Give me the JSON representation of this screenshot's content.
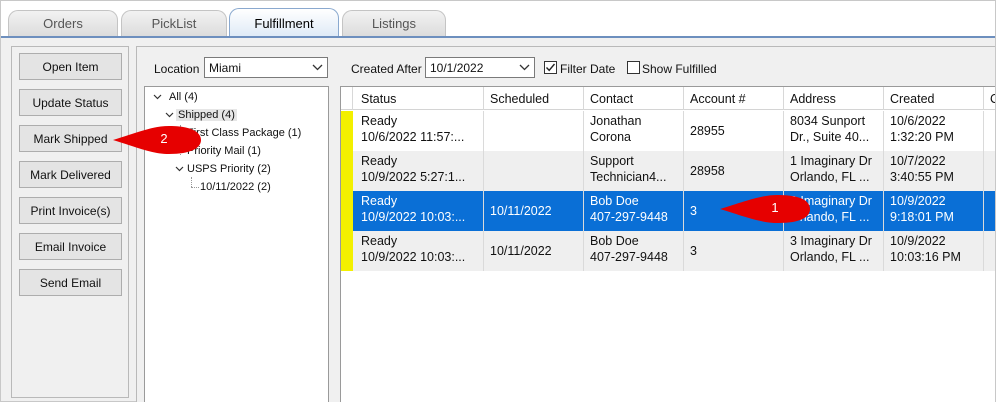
{
  "tabs": [
    {
      "label": "Orders",
      "active": false
    },
    {
      "label": "PickList",
      "active": false
    },
    {
      "label": "Fulfillment",
      "active": true
    },
    {
      "label": "Listings",
      "active": false
    }
  ],
  "sidebar_buttons": [
    {
      "label": "Open Item"
    },
    {
      "label": "Update Status"
    },
    {
      "label": "Mark Shipped"
    },
    {
      "label": "Mark Delivered"
    },
    {
      "label": "Print Invoice(s)"
    },
    {
      "label": "Email Invoice"
    },
    {
      "label": "Send Email"
    }
  ],
  "filters": {
    "location_label": "Location",
    "location_value": "Miami",
    "created_after_label": "Created After",
    "created_after_value": "10/1/2022",
    "filter_date_label": "Filter Date",
    "filter_date_checked": true,
    "show_fulfilled_label": "Show Fulfilled",
    "show_fulfilled_checked": false
  },
  "tree": {
    "root": "All (4)",
    "shipped": "Shipped (4)",
    "first_class": "First Class Package (1)",
    "priority_mail": "Priority Mail (1)",
    "usps_priority": "USPS Priority (2)",
    "date_node": "10/11/2022 (2)"
  },
  "grid": {
    "columns": [
      "Status",
      "Scheduled",
      "Contact",
      "Account #",
      "Address",
      "Created",
      "C"
    ],
    "rows": [
      {
        "status1": "Ready",
        "status2": "10/6/2022 11:57:...",
        "scheduled": "",
        "contact1": "Jonathan",
        "contact2": "Corona",
        "account": "28955",
        "address1": "8034 Sunport",
        "address2": "Dr., Suite 40...",
        "created1": "10/6/2022",
        "created2": "1:32:20 PM",
        "selected": false
      },
      {
        "status1": "Ready",
        "status2": "10/9/2022 5:27:1...",
        "scheduled": "",
        "contact1": "Support",
        "contact2": "Technician4...",
        "account": "28958",
        "address1": "1 Imaginary Dr",
        "address2": "Orlando, FL ...",
        "created1": "10/7/2022",
        "created2": "3:40:55 PM",
        "selected": false
      },
      {
        "status1": "Ready",
        "status2": "10/9/2022 10:03:...",
        "scheduled": "10/11/2022",
        "contact1": "Bob Doe",
        "contact2": "407-297-9448",
        "account": "3",
        "address1": "3 Imaginary Dr",
        "address2": "Orlando, FL ...",
        "created1": "10/9/2022",
        "created2": "9:18:01 PM",
        "selected": true
      },
      {
        "status1": "Ready",
        "status2": "10/9/2022 10:03:...",
        "scheduled": "10/11/2022",
        "contact1": "Bob Doe",
        "contact2": "407-297-9448",
        "account": "3",
        "address1": "3 Imaginary Dr",
        "address2": "Orlando, FL ...",
        "created1": "10/9/2022",
        "created2": "10:03:16 PM",
        "selected": false
      }
    ]
  },
  "callouts": {
    "one": "1",
    "two": "2"
  },
  "colors": {
    "selection_blue": "#0a6fd6",
    "status_yellow": "#f3f000",
    "callout_red": "#e60000"
  }
}
